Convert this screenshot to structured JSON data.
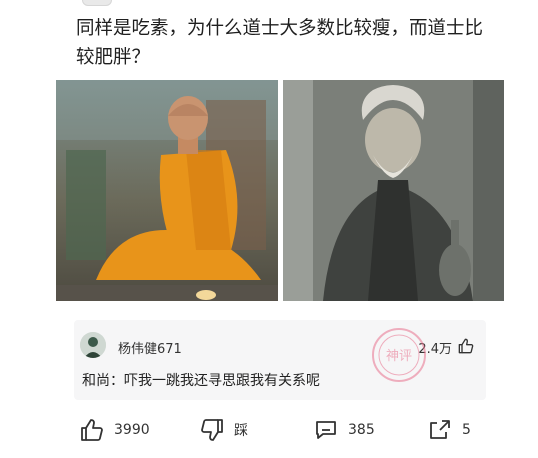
{
  "question": {
    "title": "同样是吃素，为什么道士大多数比较瘦，而道士比较肥胖？"
  },
  "images": [
    {
      "subject": "seated-monk-orange-robe"
    },
    {
      "subject": "old-taoist-grayscale"
    }
  ],
  "comment": {
    "username": "杨伟健671",
    "likes": "2.4万",
    "text": "和尚：吓我一跳我还寻思跟我有关系呢",
    "stamp_text": "神评"
  },
  "actions": {
    "like_count": "3990",
    "dislike_label": "踩",
    "comment_count": "385",
    "share_count": "5"
  },
  "colors": {
    "stamp": "#e8738e",
    "robe": "#e8941a"
  }
}
